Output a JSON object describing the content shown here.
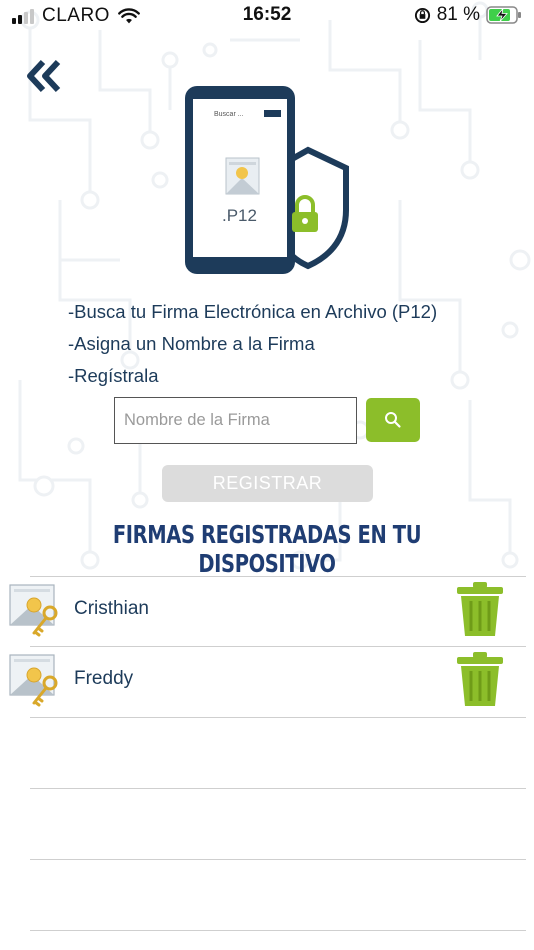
{
  "status_bar": {
    "carrier": "CLARO",
    "time": "16:52",
    "battery_percent": "81 %"
  },
  "hero": {
    "search_placeholder": "Buscar ...",
    "file_extension": ".P12"
  },
  "instructions": [
    "-Busca tu Firma Electrónica en Archivo (P12)",
    "-Asigna un Nombre a la Firma",
    "-Regístrala"
  ],
  "form": {
    "name_placeholder": "Nombre de la Firma",
    "name_value": "",
    "register_label": "REGISTRAR"
  },
  "section_title": "FIRMAS REGISTRADAS EN TU DISPOSITIVO",
  "signatures": [
    {
      "name": "Cristhian"
    },
    {
      "name": "Freddy"
    }
  ],
  "colors": {
    "brand_navy": "#1d3b5a",
    "accent_green": "#8cbe2a",
    "title_blue": "#1f3d73"
  },
  "icons": [
    "back-chevrons-icon",
    "search-icon",
    "certificate-key-icon",
    "trash-icon",
    "padlock-icon",
    "wifi-icon"
  ]
}
